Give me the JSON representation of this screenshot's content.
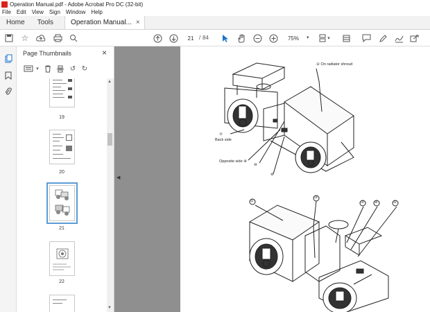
{
  "window": {
    "title": "Operation Manual.pdf - Adobe Acrobat Pro DC (32-bit)"
  },
  "menu": [
    "File",
    "Edit",
    "View",
    "Sign",
    "Window",
    "Help"
  ],
  "tabs": {
    "home": "Home",
    "tools": "Tools",
    "document": "Operation Manual...",
    "close": "×"
  },
  "toolbar": {
    "page_current": "21",
    "page_sep": "/",
    "page_total": "84",
    "zoom": "75%"
  },
  "panel": {
    "title": "Page Thumbnails",
    "thumbnails": [
      {
        "label": "19"
      },
      {
        "label": "20"
      },
      {
        "label": "21",
        "selected": true
      },
      {
        "label": "22"
      }
    ]
  },
  "figure1": {
    "callouts": [
      "② On radiator shroud",
      "⑦",
      "Back side",
      "Opposite side ⑧",
      "⑩",
      "⑥"
    ]
  },
  "figure2": {
    "callouts": [
      "①",
      "③",
      "③",
      "④",
      "⑤"
    ]
  },
  "colors": {
    "accent": "#5b9bd5",
    "doc_bg": "#8f8f8f",
    "acrobat_red": "#d9231b"
  }
}
